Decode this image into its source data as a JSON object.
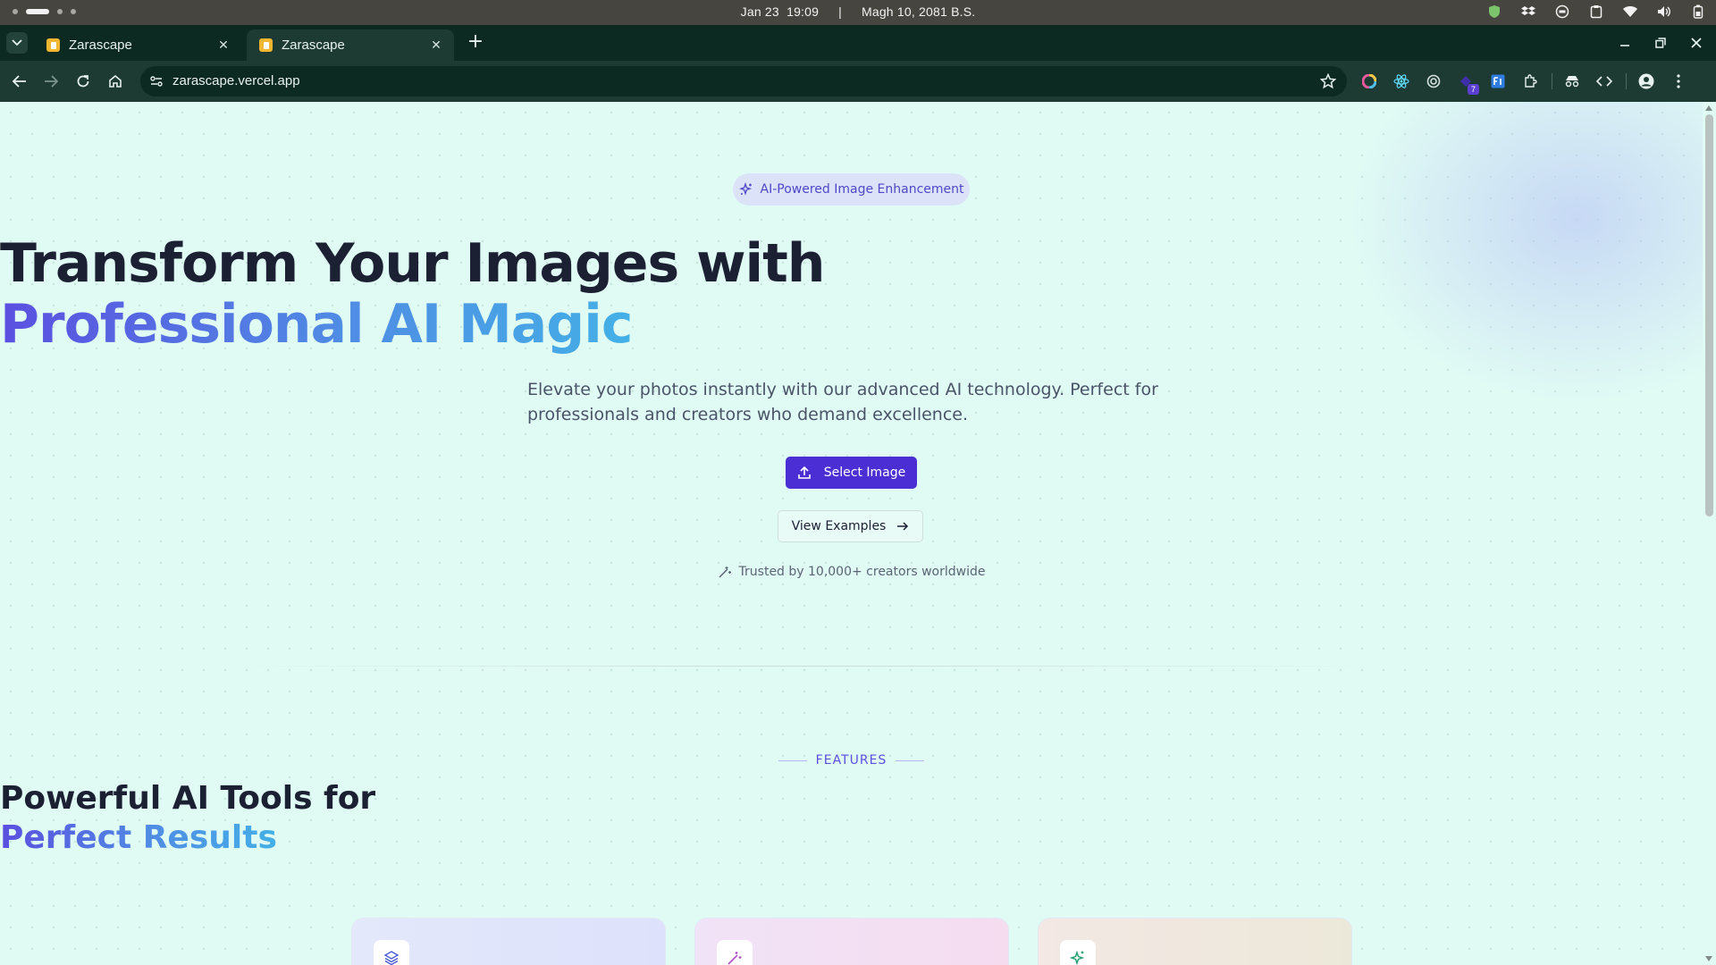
{
  "os": {
    "date": "Jan 23",
    "time": "19:09",
    "separator": "|",
    "alt_date": "Magh 10, 2081 B.S."
  },
  "browser": {
    "tabs": [
      {
        "title": "Zarascape",
        "active": false
      },
      {
        "title": "Zarascape",
        "active": true
      }
    ],
    "url": "zarascape.vercel.app",
    "extension_badge": "7"
  },
  "hero": {
    "badge": "AI-Powered Image Enhancement",
    "title_line1": "Transform Your Images with",
    "title_line2": "Professional AI Magic",
    "subtitle": "Elevate your photos instantly with our advanced AI technology. Perfect for professionals and creators who demand excellence.",
    "primary_button": "Select Image",
    "secondary_button": "View Examples",
    "trusted_text": "Trusted by 10,000+ creators worldwide"
  },
  "features": {
    "eyebrow": "FEATURES",
    "title_line1": "Powerful AI Tools for",
    "title_line2": "Perfect Results",
    "cards": [
      {
        "icon": "layers-icon",
        "accent": "#4b5ad6"
      },
      {
        "icon": "magic-wand-icon",
        "accent": "#b04fc8"
      },
      {
        "icon": "sparkles-icon",
        "accent": "#1e9a6a"
      }
    ]
  },
  "colors": {
    "page_bg": "#e0fbf4",
    "primary": "#4b2fd4",
    "heading": "#1b2033",
    "gradient_start": "#5b4fe0",
    "gradient_end": "#44b0e6",
    "browser_frame": "#1d3b33"
  }
}
